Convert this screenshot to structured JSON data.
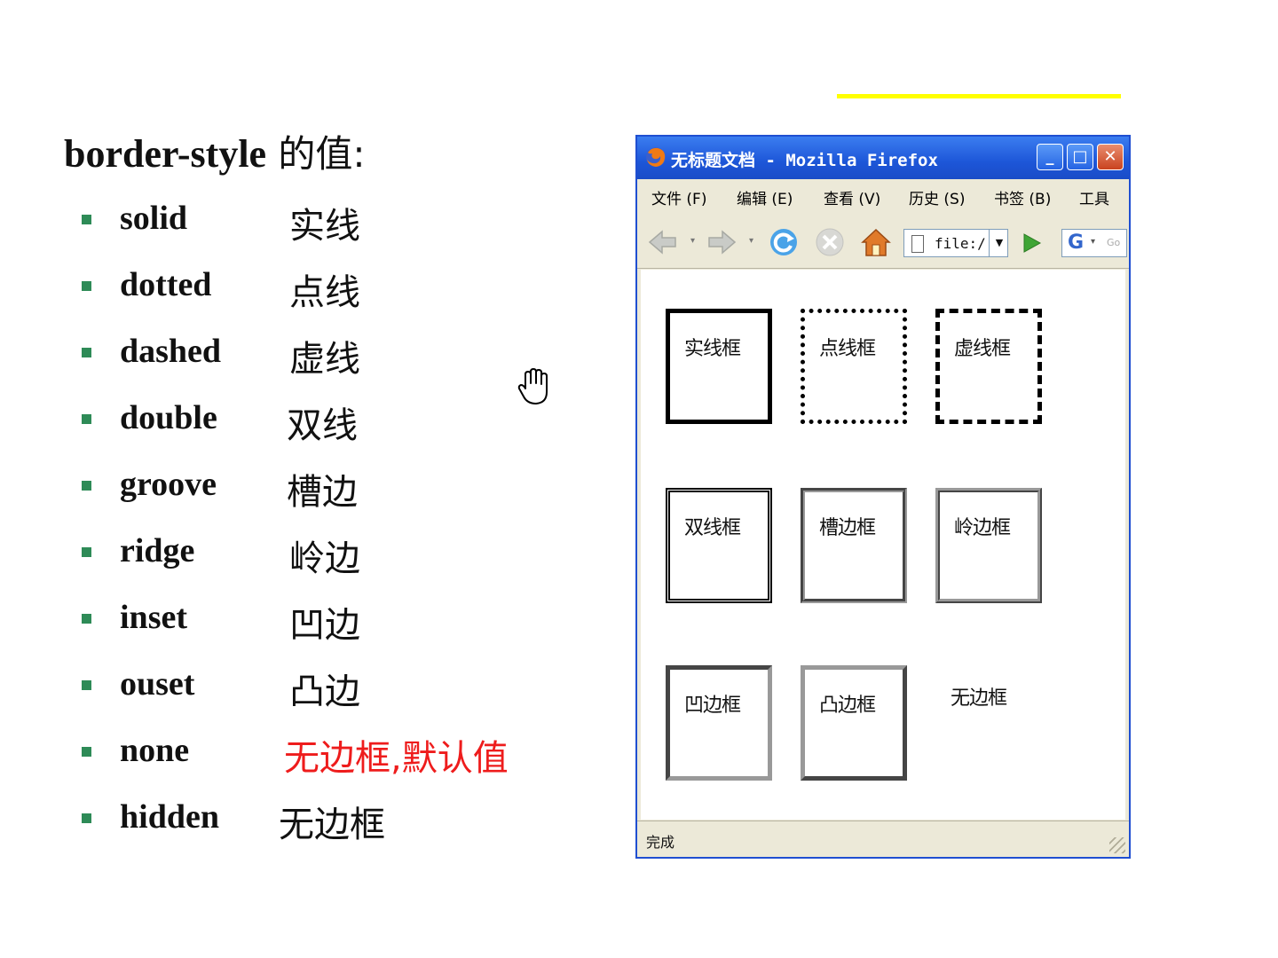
{
  "slide": {
    "title_en": "border-style",
    "title_zh": " 的值:"
  },
  "bullets": [
    {
      "term": "solid",
      "desc": "实线"
    },
    {
      "term": "dotted",
      "desc": "点线"
    },
    {
      "term": "dashed",
      "desc": "虚线"
    },
    {
      "term": "double",
      "desc": "双线"
    },
    {
      "term": "groove",
      "desc": "槽边"
    },
    {
      "term": "ridge",
      "desc": "岭边"
    },
    {
      "term": "inset",
      "desc": "凹边"
    },
    {
      "term": "ouset",
      "desc": "凸边"
    },
    {
      "term": "none",
      "desc": "无边框,默认值"
    },
    {
      "term": "hidden",
      "desc": "无边框"
    }
  ],
  "colors": {
    "accent_line": "#ffff00",
    "bullet_marker": "#2e8b57",
    "highlight_text": "#ee1c1c",
    "window_border": "#1f4fd1"
  },
  "browser": {
    "title": "无标题文档 - Mozilla Firefox",
    "menu": [
      "文件 (F)",
      "编辑 (E)",
      "查看 (V)",
      "历史 (S)",
      "书签 (B)",
      "工具"
    ],
    "url": "file:/",
    "search_placeholder": "Go",
    "search_logo": "G",
    "status": "完成",
    "demo_boxes": [
      {
        "label": "实线框"
      },
      {
        "label": "点线框"
      },
      {
        "label": "虚线框"
      },
      {
        "label": "双线框"
      },
      {
        "label": "槽边框"
      },
      {
        "label": "岭边框"
      },
      {
        "label": "凹边框"
      },
      {
        "label": "凸边框"
      },
      {
        "label": "无边框"
      }
    ]
  },
  "icons": {
    "back": "back-arrow-icon",
    "forward": "forward-arrow-icon",
    "reload": "reload-icon",
    "stop": "stop-icon",
    "home": "home-icon",
    "go": "go-arrow-icon",
    "cursor": "hand-cursor-icon"
  }
}
